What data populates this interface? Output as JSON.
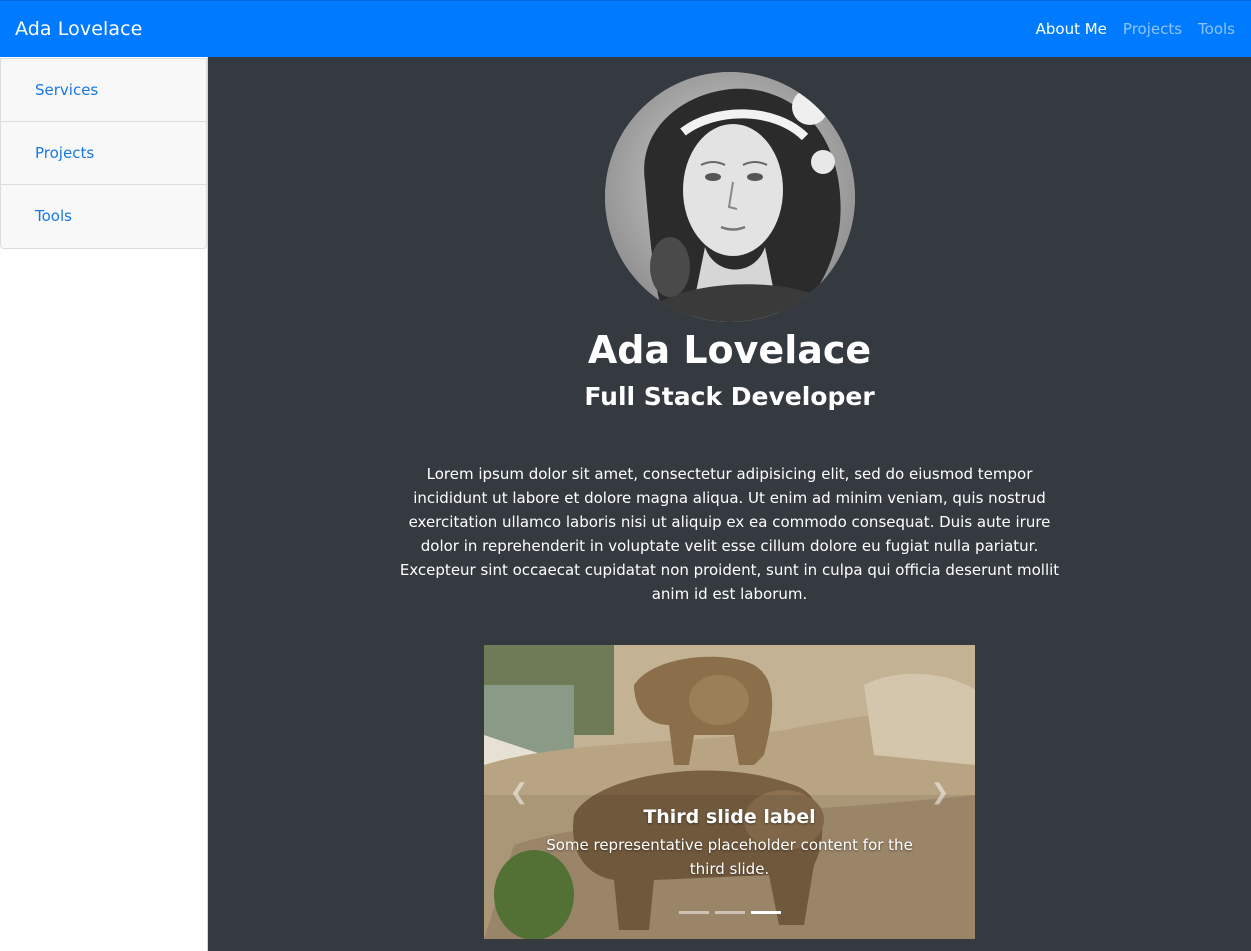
{
  "navbar": {
    "brand": "Ada Lovelace",
    "links": [
      {
        "label": "About Me",
        "active": true
      },
      {
        "label": "Projects",
        "active": false
      },
      {
        "label": "Tools",
        "active": false
      }
    ]
  },
  "sidebar": {
    "items": [
      {
        "label": "Services"
      },
      {
        "label": "Projects"
      },
      {
        "label": "Tools"
      }
    ]
  },
  "profile": {
    "name": "Ada Lovelace",
    "role": "Full Stack Developer",
    "bio": "Lorem ipsum dolor sit amet, consectetur adipisicing elit, sed do eiusmod tempor incididunt ut labore et dolore magna aliqua. Ut enim ad minim veniam, quis nostrud exercitation ullamco laboris nisi ut aliquip ex ea commodo consequat. Duis aute irure dolor in reprehenderit in voluptate velit esse cillum dolore eu fugiat nulla pariatur. Excepteur sint occaecat cupidatat non proident, sunt in culpa qui officia deserunt mollit anim id est laborum."
  },
  "carousel": {
    "caption_title": "Third slide label",
    "caption_text": "Some representative placeholder content for the third slide.",
    "slide_count": 3,
    "active_slide": 3
  },
  "colors": {
    "navbar": "#007bff",
    "main_bg": "#343a40",
    "link": "#1877e6"
  },
  "icons": {
    "prev": "chevron-left-icon",
    "next": "chevron-right-icon"
  }
}
